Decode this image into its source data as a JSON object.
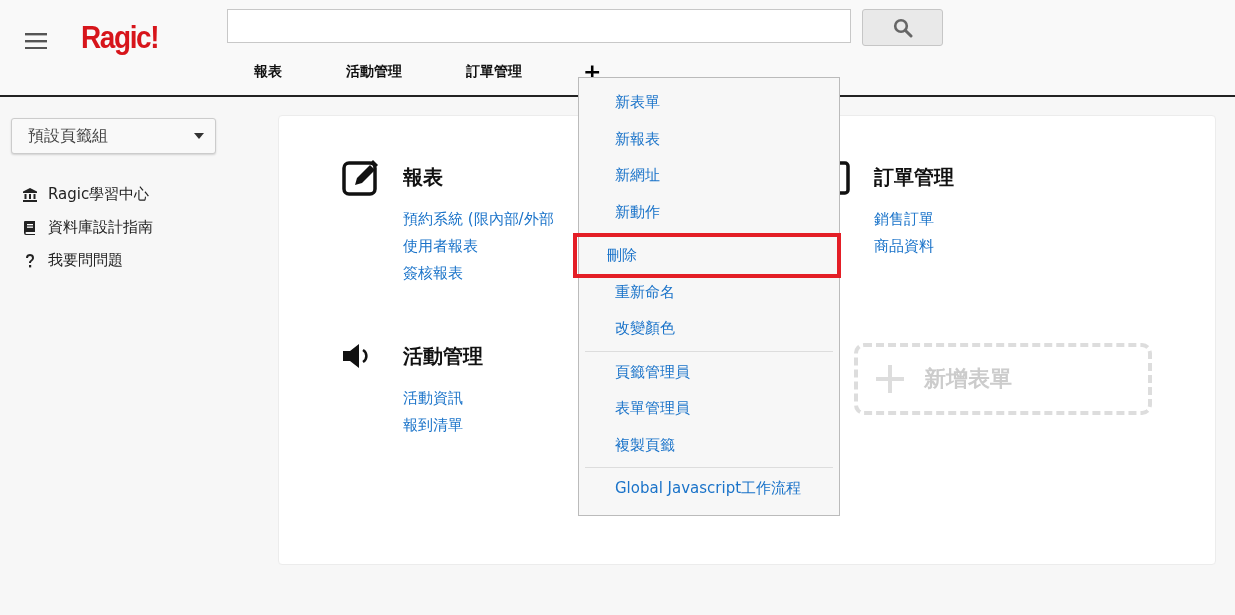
{
  "header": {
    "logo": "Ragic!",
    "tabs": [
      {
        "label": "報表",
        "selected": false
      },
      {
        "label": "活動管理",
        "selected": false
      },
      {
        "label": "訂單管理",
        "selected": false
      }
    ],
    "add_tab": "+"
  },
  "sidebar": {
    "tab_group": "預設頁籤組",
    "links": [
      {
        "kind": "bank",
        "label": "Ragic學習中心"
      },
      {
        "kind": "book",
        "label": "資料庫設計指南"
      },
      {
        "kind": "question",
        "label": "我要問問題"
      }
    ]
  },
  "sections": [
    {
      "kind": "edit",
      "title": "報表",
      "items": [
        "預約系統 (限內部/外部",
        "使用者報表",
        "簽核報表"
      ]
    },
    {
      "kind": "order",
      "title": "訂單管理",
      "items": [
        "銷售訂單",
        "商品資料"
      ]
    },
    {
      "kind": "speaker",
      "title": "活動管理",
      "items": [
        "活動資訊",
        "報到清單"
      ]
    }
  ],
  "add_form": {
    "label": "新增表單"
  },
  "context_menu": {
    "groups": [
      {
        "items": [
          {
            "label": "新表單",
            "marked": false
          },
          {
            "label": "新報表",
            "marked": false
          },
          {
            "label": "新網址",
            "marked": false
          },
          {
            "label": "新動作",
            "marked": false
          }
        ]
      },
      {
        "items": [
          {
            "label": "刪除",
            "marked": true
          },
          {
            "label": "重新命名",
            "marked": false
          },
          {
            "label": "改變顏色",
            "marked": false
          }
        ]
      },
      {
        "items": [
          {
            "label": "頁籤管理員",
            "marked": false
          },
          {
            "label": "表單管理員",
            "marked": false
          },
          {
            "label": "複製頁籤",
            "marked": false
          }
        ]
      },
      {
        "items": [
          {
            "label": "Global Javascript工作流程",
            "marked": false
          }
        ]
      }
    ]
  }
}
